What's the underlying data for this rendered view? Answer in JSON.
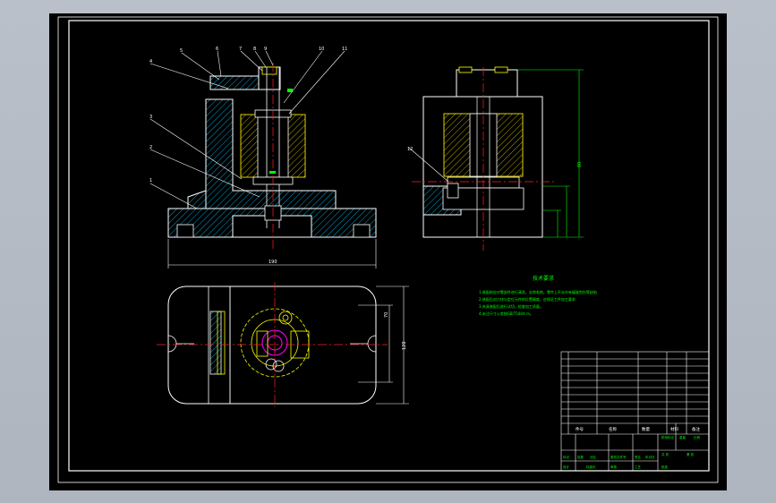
{
  "drawing": {
    "side_view": {
      "balloons": [
        "1",
        "2",
        "3",
        "4",
        "5",
        "6",
        "7",
        "8",
        "9",
        "10",
        "11"
      ],
      "width_dim": "190"
    },
    "front_view": {
      "balloon": "12",
      "height_dim": "80"
    },
    "top_view": {
      "dim_a": "70",
      "dim_b": "120"
    },
    "tech_req": {
      "title": "技术要求",
      "lines": [
        "1.装配前应对零部件进行清洗，去除毛刺。零件上不允许有磕碰划伤等缺陷",
        "2.装配后对刀块与定位元件的位置精度，应保证工件加工要求",
        "3.夹具装配后进行试切，检查加工质量。",
        "4.未注尺寸公差按GB/T1804-m。"
      ]
    },
    "title_block": {
      "labels": [
        "标记",
        "处数",
        "分区",
        "更改文件号",
        "签名",
        "年月日",
        "设计",
        "标准化",
        "审核",
        "工艺",
        "批准",
        "阶段标记",
        "重量",
        "比例",
        "共 张",
        "第 张"
      ],
      "parts": [
        "件号",
        "名称",
        "数量",
        "材料",
        "备注"
      ]
    }
  },
  "colors": {
    "background": "#000000",
    "outline": "#ffffff",
    "hatch": "#00c8ff",
    "dimension": "#00ff00",
    "centerline": "#ff2020",
    "spring": "#ffff00",
    "hidden": "#ff00ff",
    "frame": "#ffffff"
  }
}
